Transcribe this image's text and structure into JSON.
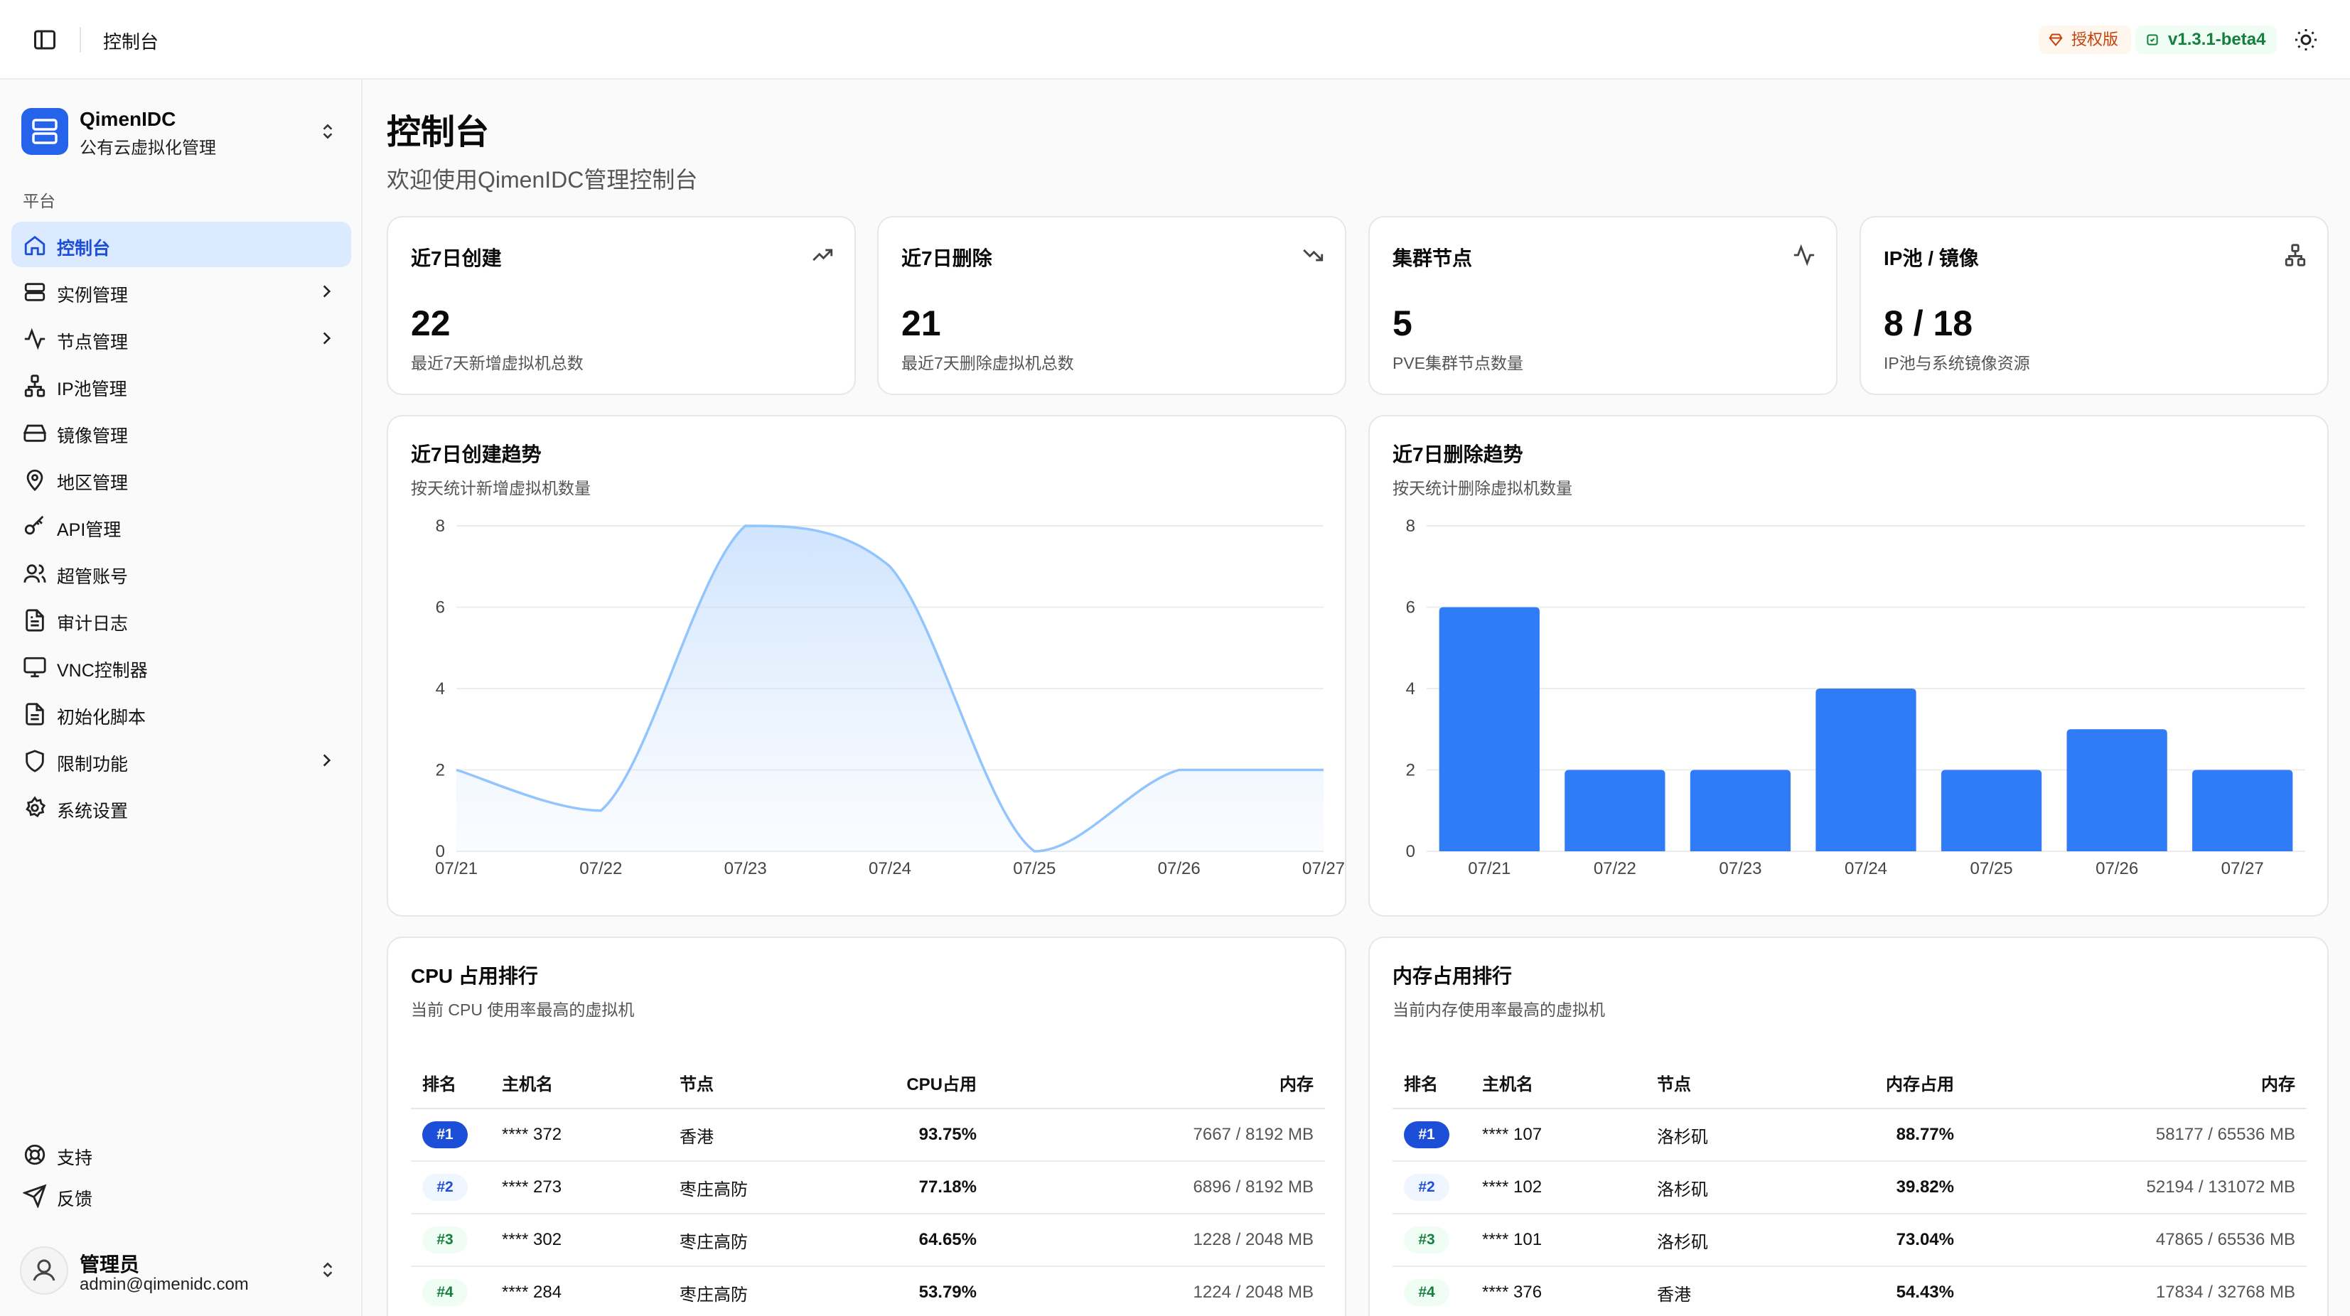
{
  "topbar": {
    "title": "控制台",
    "license_badge": "授权版",
    "version_badge": "v1.3.1-beta4"
  },
  "org": {
    "name": "QimenIDC",
    "subtitle": "公有云虚拟化管理"
  },
  "sidebar": {
    "section_label": "平台",
    "items": [
      {
        "label": "控制台",
        "icon": "home-icon",
        "active": true,
        "has_children": false
      },
      {
        "label": "实例管理",
        "icon": "server-icon",
        "has_children": true
      },
      {
        "label": "节点管理",
        "icon": "activity-icon",
        "has_children": true
      },
      {
        "label": "IP池管理",
        "icon": "network-icon",
        "has_children": false
      },
      {
        "label": "镜像管理",
        "icon": "hard-drive-icon",
        "has_children": false
      },
      {
        "label": "地区管理",
        "icon": "map-pin-icon",
        "has_children": false
      },
      {
        "label": "API管理",
        "icon": "key-icon",
        "has_children": false
      },
      {
        "label": "超管账号",
        "icon": "users-icon",
        "has_children": false
      },
      {
        "label": "审计日志",
        "icon": "file-text-icon",
        "has_children": false
      },
      {
        "label": "VNC控制器",
        "icon": "monitor-icon",
        "has_children": false
      },
      {
        "label": "初始化脚本",
        "icon": "file-script-icon",
        "has_children": false
      },
      {
        "label": "限制功能",
        "icon": "shield-icon",
        "has_children": true
      },
      {
        "label": "系统设置",
        "icon": "gear-icon",
        "has_children": false
      }
    ],
    "support": [
      {
        "label": "支持",
        "icon": "life-buoy-icon"
      },
      {
        "label": "反馈",
        "icon": "send-icon"
      }
    ],
    "user": {
      "name": "管理员",
      "email": "admin@qimenidc.com"
    }
  },
  "page": {
    "title": "控制台",
    "subtitle": "欢迎使用QimenIDC管理控制台"
  },
  "stats": [
    {
      "title": "近7日创建",
      "value": "22",
      "sub": "最近7天新增虚拟机总数",
      "icon": "trending-up-icon"
    },
    {
      "title": "近7日删除",
      "value": "21",
      "sub": "最近7天删除虚拟机总数",
      "icon": "trending-down-icon"
    },
    {
      "title": "集群节点",
      "value": "5",
      "sub": "PVE集群节点数量",
      "icon": "activity-icon"
    },
    {
      "title": "IP池 / 镜像",
      "value": "8 / 18",
      "sub": "IP池与系统镜像资源",
      "icon": "network-icon"
    }
  ],
  "charts": {
    "create": {
      "title": "近7日创建趋势",
      "subtitle": "按天统计新增虚拟机数量"
    },
    "delete": {
      "title": "近7日删除趋势",
      "subtitle": "按天统计删除虚拟机数量"
    }
  },
  "chart_data": [
    {
      "type": "area",
      "categories": [
        "07/21",
        "07/22",
        "07/23",
        "07/24",
        "07/25",
        "07/26",
        "07/27"
      ],
      "values": [
        2,
        1,
        8,
        7,
        0,
        2,
        2
      ],
      "title": "近7日创建趋势",
      "ylim": [
        0,
        8
      ],
      "yticks": [
        0,
        2,
        4,
        6,
        8
      ],
      "color": "#93c5fd",
      "grid": true
    },
    {
      "type": "bar",
      "categories": [
        "07/21",
        "07/22",
        "07/23",
        "07/24",
        "07/25",
        "07/26",
        "07/27"
      ],
      "values": [
        6,
        2,
        2,
        4,
        2,
        3,
        2
      ],
      "title": "近7日删除趋势",
      "ylim": [
        0,
        8
      ],
      "yticks": [
        0,
        2,
        4,
        6,
        8
      ],
      "color": "#2f7cf6",
      "grid": true
    }
  ],
  "cpu_rank": {
    "title": "CPU 占用排行",
    "subtitle": "当前 CPU 使用率最高的虚拟机",
    "columns": [
      "排名",
      "主机名",
      "节点",
      "CPU占用",
      "内存"
    ],
    "rows": [
      {
        "rank": "#1",
        "host": "**** 372",
        "node": "香港",
        "usage": "93.75%",
        "mem": "7667 / 8192 MB"
      },
      {
        "rank": "#2",
        "host": "**** 273",
        "node": "枣庄高防",
        "usage": "77.18%",
        "mem": "6896 / 8192 MB"
      },
      {
        "rank": "#3",
        "host": "**** 302",
        "node": "枣庄高防",
        "usage": "64.65%",
        "mem": "1228 / 2048 MB"
      },
      {
        "rank": "#4",
        "host": "**** 284",
        "node": "枣庄高防",
        "usage": "53.79%",
        "mem": "1224 / 2048 MB"
      }
    ]
  },
  "mem_rank": {
    "title": "内存占用排行",
    "subtitle": "当前内存使用率最高的虚拟机",
    "columns": [
      "排名",
      "主机名",
      "节点",
      "内存占用",
      "内存"
    ],
    "rows": [
      {
        "rank": "#1",
        "host": "**** 107",
        "node": "洛杉矶",
        "usage": "88.77%",
        "mem": "58177 / 65536 MB"
      },
      {
        "rank": "#2",
        "host": "**** 102",
        "node": "洛杉矶",
        "usage": "39.82%",
        "mem": "52194 / 131072 MB"
      },
      {
        "rank": "#3",
        "host": "**** 101",
        "node": "洛杉矶",
        "usage": "73.04%",
        "mem": "47865 / 65536 MB"
      },
      {
        "rank": "#4",
        "host": "**** 376",
        "node": "香港",
        "usage": "54.43%",
        "mem": "17834 / 32768 MB"
      }
    ]
  }
}
